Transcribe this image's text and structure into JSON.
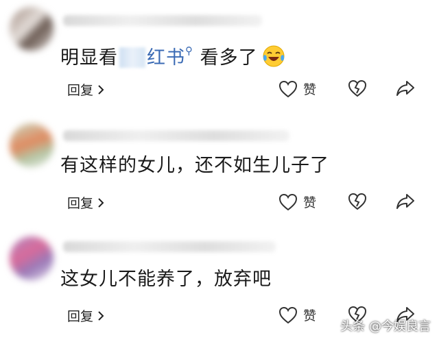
{
  "comments": [
    {
      "text_before": "明显看",
      "link_text": "红书",
      "search_mark": "⚲",
      "text_after": " 看多了",
      "emoji": "laughing-crying-face",
      "reply_label": "回复",
      "like_label": "赞"
    },
    {
      "text": "有这样的女儿，还不如生儿子了",
      "reply_label": "回复",
      "like_label": "赞"
    },
    {
      "text": "这女儿不能养了，放弃吧",
      "reply_label": "回复",
      "like_label": "赞"
    }
  ],
  "watermark": "头条 @今娱良言",
  "colors": {
    "link": "#3a6ab4",
    "icon_stroke": "#333333",
    "background": "#ffffff"
  }
}
